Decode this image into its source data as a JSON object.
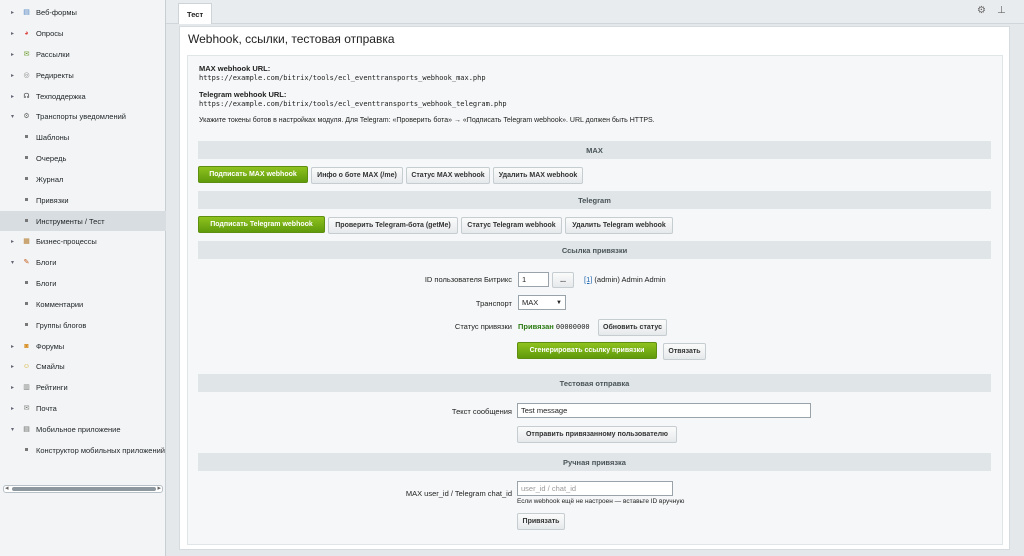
{
  "sidebar": {
    "items": [
      {
        "label": "Веб-формы",
        "arrow": "▸",
        "icon": "form-icon",
        "glyph": "▤",
        "color": "#4a7fc1"
      },
      {
        "label": "Опросы",
        "arrow": "▸",
        "icon": "poll-icon",
        "glyph": "◕",
        "color": "#d44"
      },
      {
        "label": "Рассылки",
        "arrow": "▸",
        "icon": "mail-icon",
        "glyph": "✉",
        "color": "#6a9a2a"
      },
      {
        "label": "Редиректы",
        "arrow": "▸",
        "icon": "redirect-icon",
        "glyph": "◎",
        "color": "#888"
      },
      {
        "label": "Техподдержка",
        "arrow": "▸",
        "icon": "headset-icon",
        "glyph": "☊",
        "color": "#444"
      },
      {
        "label": "Транспорты уведомлений",
        "arrow": "▾",
        "icon": "gear-icon",
        "glyph": "⚙",
        "color": "#666"
      },
      {
        "label": "Шаблоны"
      },
      {
        "label": "Очередь"
      },
      {
        "label": "Журнал"
      },
      {
        "label": "Привязки"
      },
      {
        "label": "Инструменты / Тест",
        "active": true
      },
      {
        "label": "Бизнес-процессы",
        "arrow": "▸",
        "icon": "process-icon",
        "glyph": "▦",
        "color": "#b47a2a"
      },
      {
        "label": "Блоги",
        "arrow": "▾",
        "icon": "blog-icon",
        "glyph": "✎",
        "color": "#c55a1a"
      },
      {
        "label": "Блоги"
      },
      {
        "label": "Комментарии"
      },
      {
        "label": "Группы блогов"
      },
      {
        "label": "Форумы",
        "arrow": "▸",
        "icon": "forum-icon",
        "glyph": "◙",
        "color": "#d68a1a"
      },
      {
        "label": "Смайлы",
        "arrow": "▸",
        "icon": "smile-icon",
        "glyph": "☺",
        "color": "#d6a91a"
      },
      {
        "label": "Рейтинги",
        "arrow": "▸",
        "icon": "rating-icon",
        "glyph": "▥",
        "color": "#777"
      },
      {
        "label": "Почта",
        "arrow": "▸",
        "icon": "envelope-icon",
        "glyph": "✉",
        "color": "#777"
      },
      {
        "label": "Мобильное приложение",
        "arrow": "▾",
        "icon": "mobile-icon",
        "glyph": "▤",
        "color": "#666"
      },
      {
        "label": "Конструктор мобильных приложений"
      }
    ]
  },
  "topbar": {
    "tab": "Тест",
    "settings_icon": "⚙",
    "pin_icon": "⊥"
  },
  "page": {
    "title": "Webhook, ссылки, тестовая отправка"
  },
  "info": {
    "max_label": "MAX webhook URL:",
    "max_url": "https://example.com/bitrix/tools/ecl_eventtransports_webhook_max.php",
    "tg_label": "Telegram webhook URL:",
    "tg_url": "https://example.com/bitrix/tools/ecl_eventtransports_webhook_telegram.php",
    "note": "Укажите токены ботов в настройках модуля. Для Telegram: «Проверить бота» → «Подписать Telegram webhook». URL должен быть HTTPS."
  },
  "sections": {
    "max": "MAX",
    "telegram": "Telegram",
    "link": "Ссылка привязки",
    "test": "Тестовая отправка",
    "manual": "Ручная привязка"
  },
  "max_buttons": {
    "subscribe": "Подписать MAX webhook",
    "info": "Инфо о боте MAX (/me)",
    "status": "Статус MAX webhook",
    "delete": "Удалить MAX webhook"
  },
  "tg_buttons": {
    "subscribe": "Подписать Telegram webhook",
    "check": "Проверить Telegram-бота (getMe)",
    "status": "Статус Telegram webhook",
    "delete": "Удалить Telegram webhook"
  },
  "link_form": {
    "user_label": "ID пользователя Битрикс",
    "user_value": "1",
    "browse": "...",
    "user_link": "[1]",
    "user_name": " (admin) Admin Admin",
    "transport_label": "Транспорт",
    "transport_value": "MAX",
    "status_label": "Статус привязки",
    "status_value": "Привязан",
    "status_code": "00000000",
    "refresh": "Обновить статус",
    "generate": "Сгенерировать ссылку привязки",
    "unbind": "Отвязать"
  },
  "test_form": {
    "message_label": "Текст сообщения",
    "message_value": "Test message",
    "send": "Отправить привязанному пользователю"
  },
  "manual_form": {
    "label": "MAX user_id / Telegram chat_id",
    "placeholder": "user_id / chat_id",
    "hint": "Если webhook ещё не настроен — вставьте ID вручную",
    "bind": "Привязать"
  },
  "colors": {
    "accent_green": "#6aa514",
    "bound_green": "#2a7a12",
    "link_blue": "#2066b0"
  }
}
